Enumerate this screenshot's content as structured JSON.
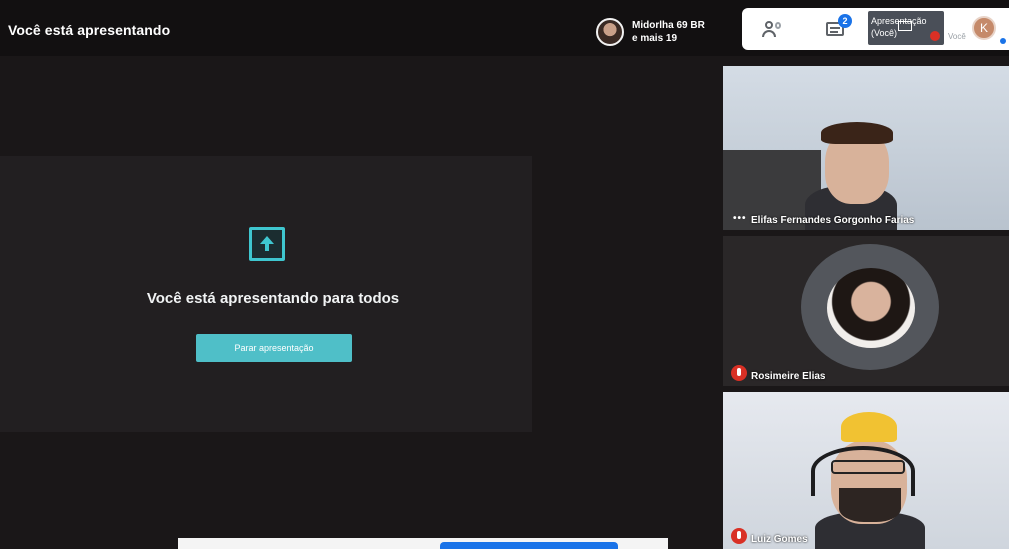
{
  "header": {
    "title": "Você está apresentando",
    "viewer_name": "Midorlha 69 BR",
    "viewer_more": "e mais 19"
  },
  "controls": {
    "people_icon": "people-icon",
    "chat_icon": "chat-icon",
    "chat_badge": "2",
    "presentation_label": "Apresentação (Você)",
    "self_label": "Você",
    "self_initial": "K"
  },
  "presentation": {
    "message": "Você está apresentando para todos",
    "stop_button": "Parar apresentação",
    "accent": "#3fc6cf"
  },
  "participants": [
    {
      "name": "Elifas Fernandes Gorgonho Farias"
    },
    {
      "name": "Rosimeire Elias"
    },
    {
      "name": "Luiz Gomes"
    }
  ]
}
